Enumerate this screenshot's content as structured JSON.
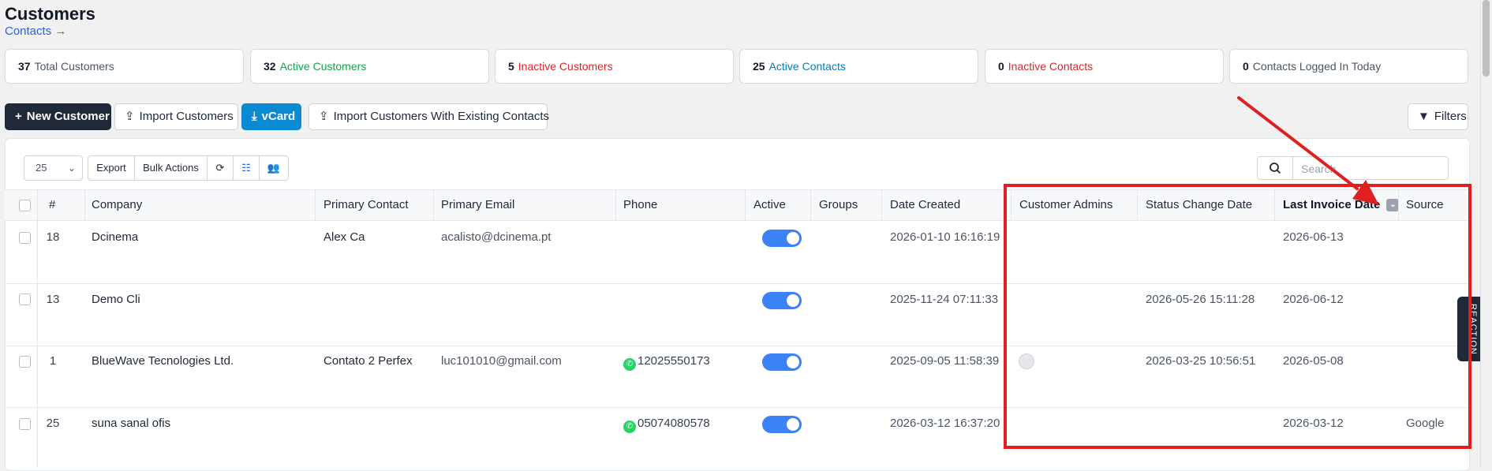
{
  "header": {
    "title": "Customers",
    "contacts_link": "Contacts →"
  },
  "stats": [
    {
      "count": "37",
      "label": "Total Customers",
      "color": "#4b5563"
    },
    {
      "count": "32",
      "label": "Active Customers",
      "color": "#16a34a"
    },
    {
      "count": "5",
      "label": "Inactive Customers",
      "color": "#dc2626"
    },
    {
      "count": "25",
      "label": "Active Contacts",
      "color": "#0b7bb5"
    },
    {
      "count": "0",
      "label": "Inactive Contacts",
      "color": "#dc2626"
    },
    {
      "count": "0",
      "label": "Contacts Logged In Today",
      "color": "#4b5563"
    }
  ],
  "toolbar": {
    "new_customer": "New Customer",
    "import_customers": "Import Customers",
    "vcard": "vCard",
    "import_with_contacts": "Import Customers With Existing Contacts",
    "filters": "Filters"
  },
  "table_tools": {
    "page_size": "25",
    "export": "Export",
    "bulk_actions": "Bulk Actions",
    "search_placeholder": "Search"
  },
  "columns": [
    "#",
    "Company",
    "Primary Contact",
    "Primary Email",
    "Phone",
    "Active",
    "Groups",
    "Date Created",
    "Customer Admins",
    "Status Change Date",
    "Last Invoice Date",
    "Source"
  ],
  "sorted_column": "Last Invoice Date",
  "rows": [
    {
      "id": "18",
      "company": "Dcinema",
      "contact": "Alex Ca",
      "email": "acalisto@dcinema.pt",
      "phone": "",
      "active": true,
      "date_created": "2026-01-10 16:16:19",
      "has_admin": false,
      "status_change": "",
      "last_invoice": "2026-06-13",
      "source": ""
    },
    {
      "id": "13",
      "company": "Demo Cli",
      "contact": "",
      "email": "",
      "phone": "",
      "active": true,
      "date_created": "2025-11-24 07:11:33",
      "has_admin": false,
      "status_change": "2026-05-26 15:11:28",
      "last_invoice": "2026-06-12",
      "source": ""
    },
    {
      "id": "1",
      "company": "BlueWave Tecnologies Ltd.",
      "contact": "Contato 2 Perfex",
      "email": "luc101010@gmail.com",
      "phone": "12025550173",
      "active": true,
      "date_created": "2025-09-05 11:58:39",
      "has_admin": true,
      "status_change": "2026-03-25 10:56:51",
      "last_invoice": "2026-05-08",
      "source": ""
    },
    {
      "id": "25",
      "company": "suna sanal ofis",
      "contact": "",
      "email": "",
      "phone": "05074080578",
      "active": true,
      "date_created": "2026-03-12 16:37:20",
      "has_admin": false,
      "status_change": "",
      "last_invoice": "2026-03-12",
      "source": "Google"
    }
  ],
  "side_tab": "REACTION",
  "annotation_color": "#e02020"
}
